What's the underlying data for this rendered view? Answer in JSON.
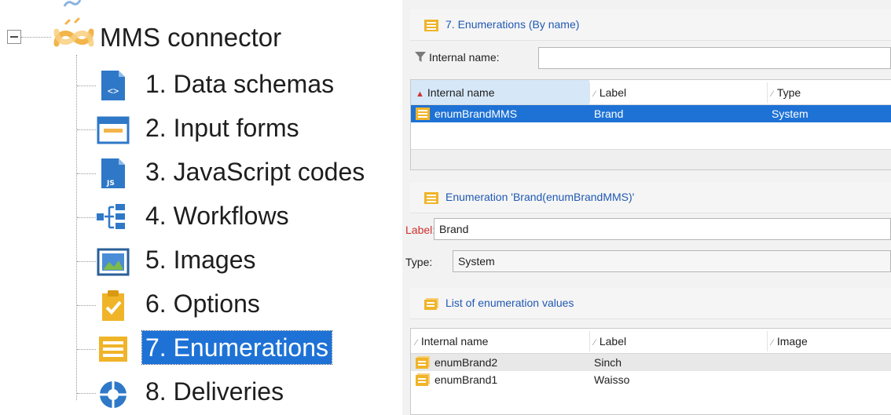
{
  "tree": {
    "root": {
      "label": "MMS connector",
      "icon": "connector-icon"
    },
    "items": [
      {
        "label": "1. Data schemas",
        "icon": "schema-file-icon"
      },
      {
        "label": "2. Input forms",
        "icon": "form-window-icon"
      },
      {
        "label": "3. JavaScript codes",
        "icon": "js-file-icon"
      },
      {
        "label": "4. Workflows",
        "icon": "workflow-icon"
      },
      {
        "label": "5. Images",
        "icon": "image-icon"
      },
      {
        "label": "6. Options",
        "icon": "clipboard-check-icon"
      },
      {
        "label": "7. Enumerations",
        "icon": "enumeration-icon",
        "selected": true
      },
      {
        "label": "8. Deliveries",
        "icon": "delivery-icon"
      }
    ]
  },
  "enum_list": {
    "title": "7. Enumerations (By name)",
    "filter_label": "Internal name:",
    "filter_value": "",
    "columns": [
      "Internal name",
      "Label",
      "Type"
    ],
    "rows": [
      {
        "internal_name": "enumBrandMMS",
        "label": "Brand",
        "type": "System"
      }
    ]
  },
  "detail": {
    "title": "Enumeration 'Brand(enumBrandMMS)'",
    "label_label": "Label:",
    "label_value": "Brand",
    "type_label": "Type:",
    "type_value": "System"
  },
  "values_list": {
    "title": "List of enumeration values",
    "columns": [
      "Internal name",
      "Label",
      "Image"
    ],
    "rows": [
      {
        "internal_name": "enumBrand2",
        "label": "Sinch",
        "image": ""
      },
      {
        "internal_name": "enumBrand1",
        "label": "Waisso",
        "image": ""
      }
    ]
  },
  "colors": {
    "selection": "#1e72d6",
    "section_title": "#2159b3",
    "required_label": "#d12f2f",
    "enum_icon": "#f0b429"
  }
}
